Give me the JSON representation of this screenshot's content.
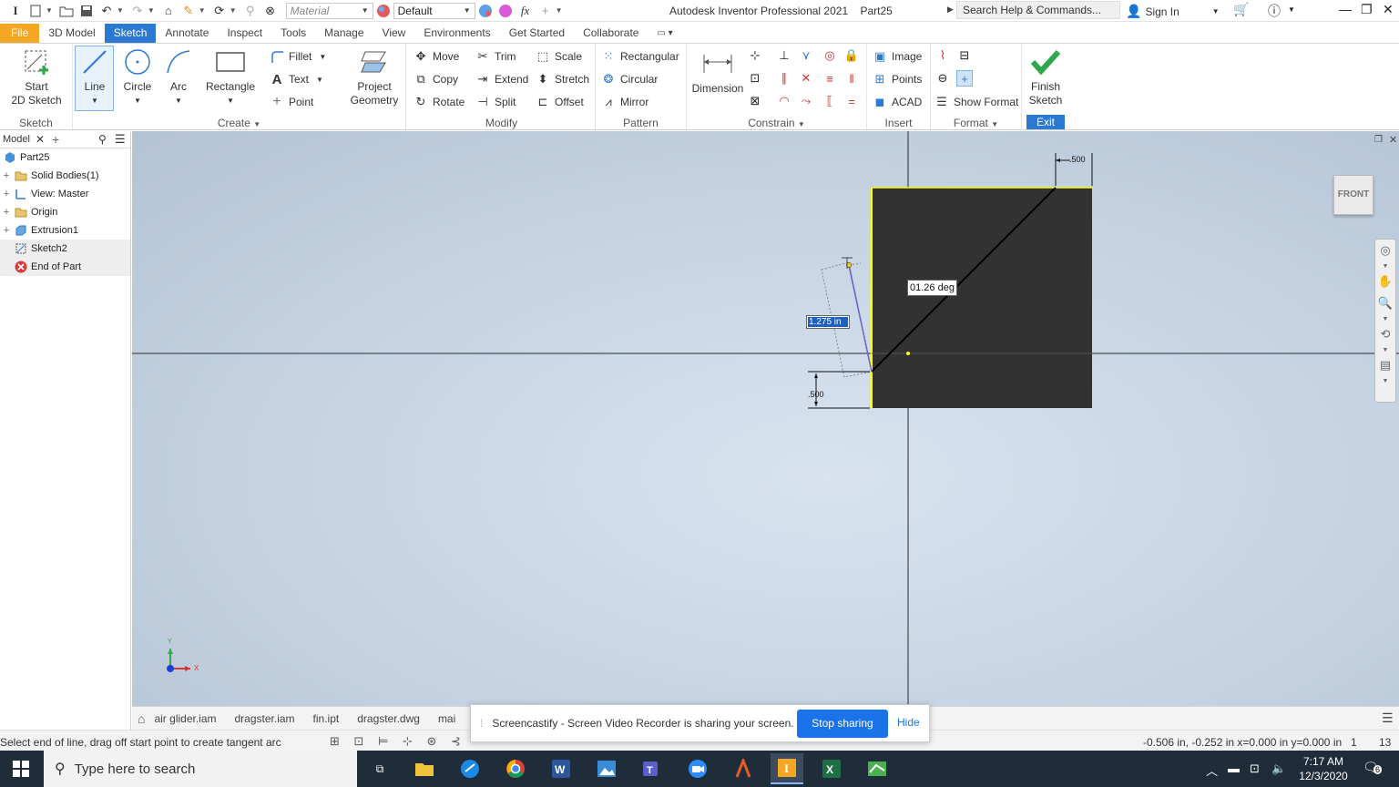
{
  "titlebar": {
    "material_placeholder": "Material",
    "appearance": "Default",
    "app_title": "Autodesk Inventor Professional 2021",
    "doc_title": "Part25",
    "search_placeholder": "Search Help & Commands...",
    "sign_in": "Sign In"
  },
  "tabs": [
    "File",
    "3D Model",
    "Sketch",
    "Annotate",
    "Inspect",
    "Tools",
    "Manage",
    "View",
    "Environments",
    "Get Started",
    "Collaborate"
  ],
  "ribbon": {
    "sketch": {
      "start_line1": "Start",
      "start_line2": "2D Sketch",
      "label": "Sketch"
    },
    "create": {
      "line": "Line",
      "circle": "Circle",
      "arc": "Arc",
      "rectangle": "Rectangle",
      "fillet": "Fillet",
      "text": "Text",
      "point": "Point",
      "project_line1": "Project",
      "project_line2": "Geometry",
      "label": "Create"
    },
    "modify": {
      "move": "Move",
      "trim": "Trim",
      "scale": "Scale",
      "copy": "Copy",
      "extend": "Extend",
      "stretch": "Stretch",
      "rotate": "Rotate",
      "split": "Split",
      "offset": "Offset",
      "label": "Modify"
    },
    "pattern": {
      "rectangular": "Rectangular",
      "circular": "Circular",
      "mirror": "Mirror",
      "label": "Pattern"
    },
    "constrain": {
      "dimension": "Dimension",
      "label": "Constrain"
    },
    "insert": {
      "image": "Image",
      "points": "Points",
      "acad": "ACAD",
      "label": "Insert"
    },
    "format": {
      "show_format": "Show Format",
      "label": "Format"
    },
    "exit": {
      "finish_line1": "Finish",
      "finish_line2": "Sketch",
      "label": "Exit"
    }
  },
  "browser": {
    "tab": "Model",
    "items": [
      {
        "label": "Part25",
        "icon": "part-icon"
      },
      {
        "label": "Solid Bodies(1)",
        "icon": "folder-icon"
      },
      {
        "label": "View: Master",
        "icon": "view-icon"
      },
      {
        "label": "Origin",
        "icon": "folder-icon"
      },
      {
        "label": "Extrusion1",
        "icon": "extrusion-icon"
      },
      {
        "label": "Sketch2",
        "icon": "sketch-icon"
      },
      {
        "label": "End of Part",
        "icon": "end-of-part-icon"
      }
    ]
  },
  "canvas": {
    "angle_input": "01.26 deg",
    "length_input": "1.275 in",
    "dim_top": ".500",
    "dim_left": ".500",
    "viewcube": "FRONT",
    "axis_x": "X",
    "axis_y": "Y"
  },
  "doc_tabs": [
    "air glider.iam",
    "dragster.iam",
    "fin.ipt",
    "dragster.dwg",
    "mai"
  ],
  "status": {
    "message": "Select end of line, drag off start point to create tangent arc",
    "coords": "-0.506 in, -0.252 in  x=0.000 in  y=0.000 in",
    "n1": "1",
    "n2": "13"
  },
  "castbar": {
    "message": "Screencastify - Screen Video Recorder is sharing your screen.",
    "stop": "Stop sharing",
    "hide": "Hide"
  },
  "taskbar": {
    "search_placeholder": "Type here to search",
    "time": "7:17 AM",
    "date": "12/3/2020",
    "notifications": "6"
  },
  "colors": {
    "accent": "#2b79d1",
    "file_tab": "#f5a623",
    "sketch_body": "#323232",
    "selection_yellow": "#ffff00",
    "finish_green": "#2ea84a"
  }
}
